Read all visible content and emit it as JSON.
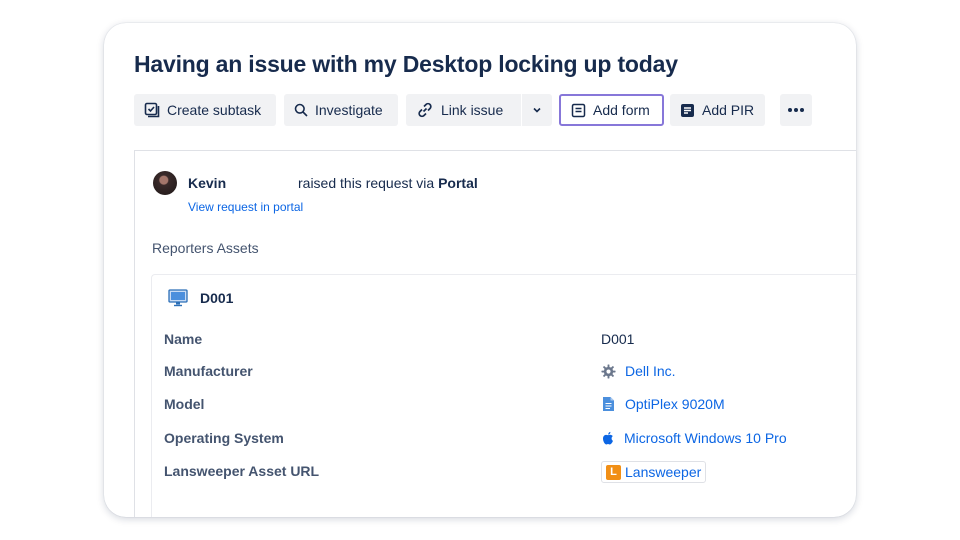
{
  "issue": {
    "title": "Having an issue with my Desktop locking up today"
  },
  "toolbar": {
    "create_subtask": "Create subtask",
    "investigate": "Investigate",
    "link_issue": "Link issue",
    "add_form": "Add form",
    "add_pir": "Add PIR",
    "more_icon": "more-horizontal-icon"
  },
  "reporter": {
    "name": "Kevin",
    "action_text": "raised this request via ",
    "channel": "Portal",
    "view_link": "View request in portal"
  },
  "assets_section": {
    "title": "Reporters Assets",
    "asset": {
      "name": "D001",
      "icon": "desktop-computer-icon",
      "fields": [
        {
          "label": "Name",
          "value": "D001",
          "type": "text"
        },
        {
          "label": "Manufacturer",
          "value": "Dell Inc.",
          "type": "link",
          "icon": "gear-icon"
        },
        {
          "label": "Model",
          "value": "OptiPlex 9020M",
          "type": "link",
          "icon": "document-icon"
        },
        {
          "label": "Operating System",
          "value": "Microsoft Windows 10 Pro",
          "type": "link",
          "icon": "apple-icon"
        },
        {
          "label": "Lansweeper Asset URL",
          "value": "Lansweeper",
          "type": "chip",
          "icon": "lansweeper-logo",
          "logo_letter": "L"
        }
      ]
    }
  },
  "colors": {
    "link": "#0c66e4",
    "focus_border": "#8777d9",
    "text": "#172b4d",
    "lansweeper_orange": "#f18f16"
  }
}
